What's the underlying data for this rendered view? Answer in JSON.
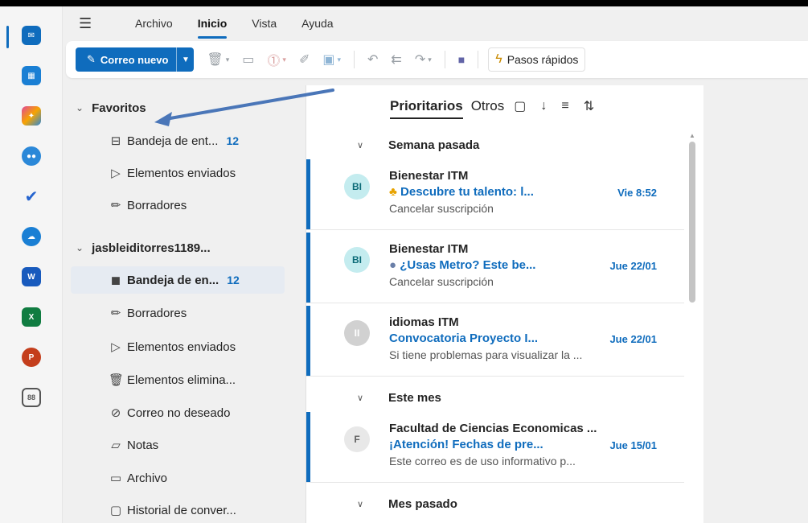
{
  "menubar": {
    "items": [
      "Archivo",
      "Inicio",
      "Vista",
      "Ayuda"
    ]
  },
  "ribbon": {
    "new_mail_label": "Correo nuevo",
    "quick_steps_label": "Pasos rápidos"
  },
  "folders": {
    "favorites_header": "Favoritos",
    "favorites": [
      {
        "label": "Bandeja de ent...",
        "count": "12"
      },
      {
        "label": "Elementos enviados",
        "count": ""
      },
      {
        "label": "Borradores",
        "count": ""
      }
    ],
    "account_header": "jasbleiditorres1189...",
    "account_items": [
      {
        "label": "Bandeja de en...",
        "count": "12"
      },
      {
        "label": "Borradores",
        "count": ""
      },
      {
        "label": "Elementos enviados",
        "count": ""
      },
      {
        "label": "Elementos elimina...",
        "count": ""
      },
      {
        "label": "Correo no deseado",
        "count": ""
      },
      {
        "label": "Notas",
        "count": ""
      },
      {
        "label": "Archivo",
        "count": ""
      },
      {
        "label": "Historial de conver...",
        "count": ""
      }
    ]
  },
  "list": {
    "tabs": [
      "Prioritarios",
      "Otros"
    ],
    "groups": [
      "Semana pasada",
      "Este mes",
      "Mes pasado"
    ],
    "messages": [
      {
        "initials": "BI",
        "sender": "Bienestar ITM",
        "subject": "Descubre tu talento: l...",
        "time": "Vie 8:52",
        "preview": "Cancelar suscripción"
      },
      {
        "initials": "BI",
        "sender": "Bienestar ITM",
        "subject": "¿Usas Metro? Este be...",
        "time": "Jue 22/01",
        "preview": "Cancelar suscripción"
      },
      {
        "initials": "II",
        "sender": "idiomas ITM",
        "subject": "Convocatoria Proyecto I...",
        "time": "Jue 22/01",
        "preview": "Si tiene problemas para visualizar la ..."
      },
      {
        "initials": "F",
        "sender": "Facultad de Ciencias Economicas ...",
        "subject": "¡Atención! Fechas de pre...",
        "time": "Jue 15/01",
        "preview": "Este correo es de uso informativo p..."
      }
    ]
  },
  "colors": {
    "accent": "#0f6cbd",
    "avatar_teal": "#c4ecef",
    "avatar_grey": "#d1d1d1"
  }
}
